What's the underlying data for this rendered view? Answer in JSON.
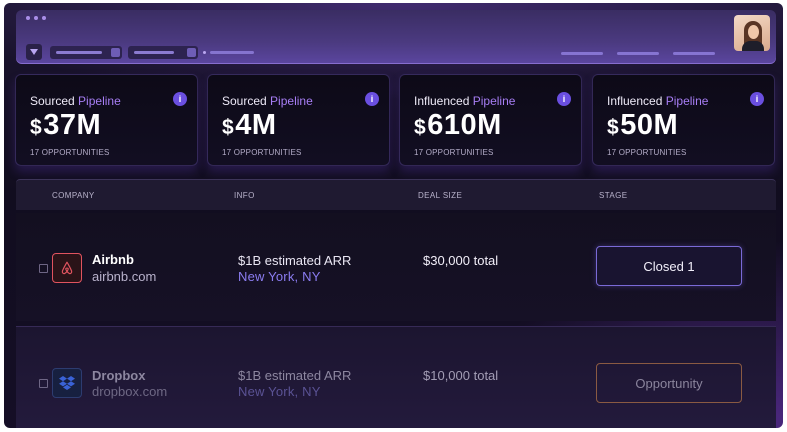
{
  "stats": [
    {
      "label_prefix": "Sourced",
      "label_highlight": "Pipeline",
      "currency": "$",
      "amount": "37M",
      "sub": "17 OPPORTUNITIES"
    },
    {
      "label_prefix": "Sourced",
      "label_highlight": "Pipeline",
      "currency": "$",
      "amount": "4M",
      "sub": "17 OPPORTUNITIES"
    },
    {
      "label_prefix": "Influenced",
      "label_highlight": "Pipeline",
      "currency": "$",
      "amount": "610M",
      "sub": "17 OPPORTUNITIES"
    },
    {
      "label_prefix": "Influenced",
      "label_highlight": "Pipeline",
      "currency": "$",
      "amount": "50M",
      "sub": "17 OPPORTUNITIES"
    }
  ],
  "info_icon_glyph": "i",
  "table": {
    "columns": [
      "COMPANY",
      "INFO",
      "DEAL SIZE",
      "STAGE"
    ],
    "rows": [
      {
        "company": "Airbnb",
        "domain": "airbnb.com",
        "arr": "$1B estimated ARR",
        "location": "New York, NY",
        "deal": "$30,000 total",
        "stage": "Closed 1"
      },
      {
        "company": "Dropbox",
        "domain": "dropbox.com",
        "arr": "$1B estimated ARR",
        "location": "New York, NY",
        "deal": "$10,000 total",
        "stage": "Opportunity"
      }
    ]
  },
  "colors": {
    "accent": "#a77ef5",
    "info_icon": "#6a4fe0",
    "airbnb": "#e0535f",
    "dropbox": "#3a62d6",
    "location": "#8b7cf0"
  },
  "icons": [
    "dropdown-icon",
    "info-icon",
    "airbnb-logo-icon",
    "dropbox-logo-icon",
    "avatar"
  ]
}
